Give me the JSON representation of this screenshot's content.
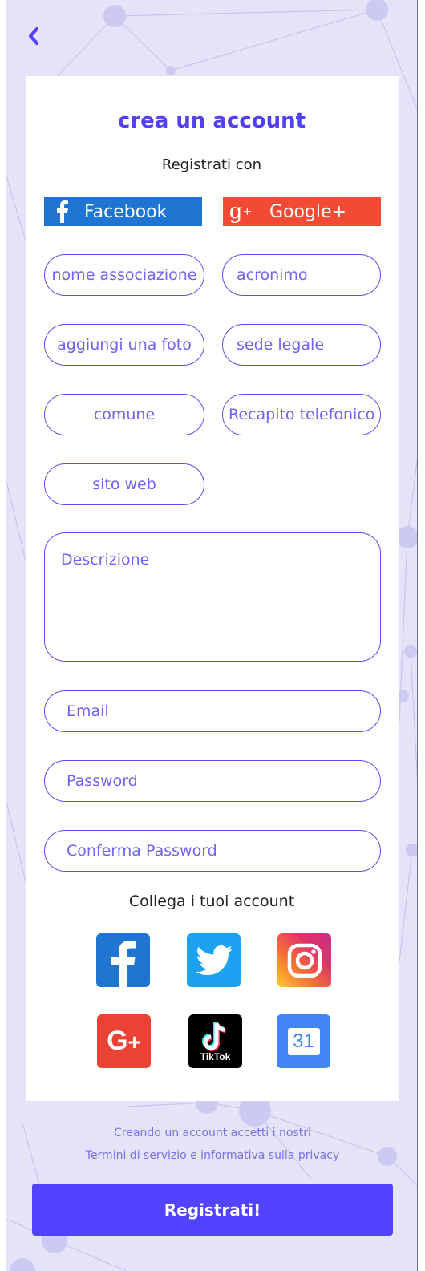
{
  "form": {
    "title": "crea un account",
    "subtitle": "Registrati con",
    "facebook_label": "Facebook",
    "google_label": "Google+",
    "fields": {
      "nome": "nome associazione",
      "acronimo": "acronimo",
      "foto": "aggiungi una foto",
      "sede": "sede legale",
      "comune": "comune",
      "recapito": "Recapito telefonico",
      "sito": "sito web",
      "descrizione": "Descrizione",
      "email": "Email",
      "password": "Password",
      "conferma": "Conferma Password"
    },
    "link_accounts_label": "Collega i tuoi account",
    "tiktok_text": "TikTok",
    "calendar_day": "31"
  },
  "footer": {
    "terms_line1": "Creando un account accetti i nostri",
    "terms_line2": "Termini di servizio e informativa sulla privacy",
    "submit_label": "Registrati!"
  },
  "colors": {
    "accent": "#5143ff",
    "background": "#e4e3f7",
    "facebook": "#1f76d2",
    "google": "#f34a35",
    "twitter": "#1da1f2"
  }
}
